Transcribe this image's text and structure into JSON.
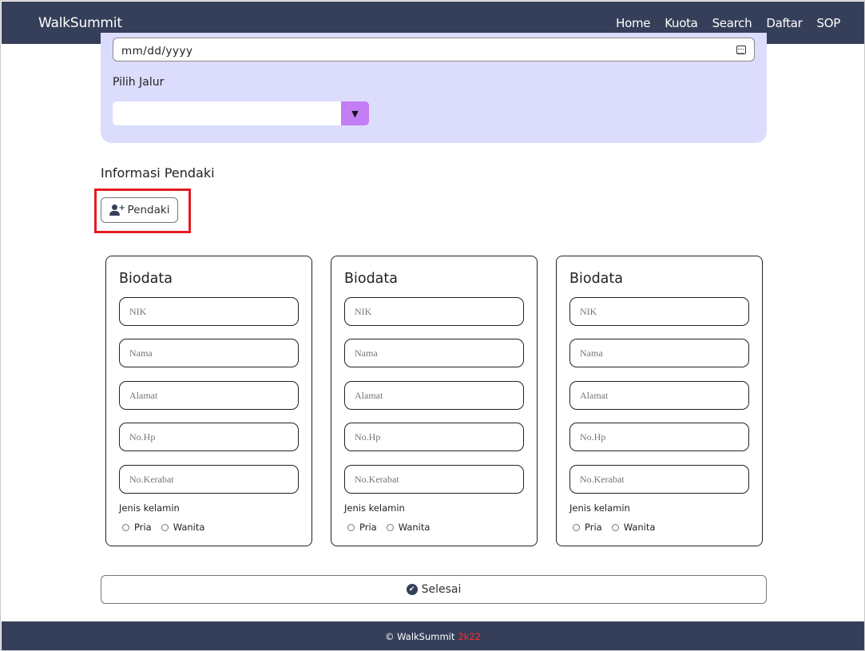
{
  "navbar": {
    "brand": "WalkSummit",
    "links": [
      "Home",
      "Kuota",
      "Search",
      "Daftar",
      "SOP"
    ]
  },
  "form": {
    "date_value": "mm/dd/yyyy",
    "jalur_label": "Pilih Jalur",
    "jalur_value": "",
    "dropdown_glyph": "▼"
  },
  "info": {
    "title": "Informasi Pendaki",
    "add_button_label": "Pendaki"
  },
  "cards": [
    {
      "title": "Biodata",
      "placeholders": [
        "NIK",
        "Nama",
        "Alamat",
        "No.Hp",
        "No.Kerabat"
      ],
      "gender_label": "Jenis kelamin",
      "options": [
        "Pria",
        "Wanita"
      ]
    },
    {
      "title": "Biodata",
      "placeholders": [
        "NIK",
        "Nama",
        "Alamat",
        "No.Hp",
        "No.Kerabat"
      ],
      "gender_label": "Jenis kelamin",
      "options": [
        "Pria",
        "Wanita"
      ]
    },
    {
      "title": "Biodata",
      "placeholders": [
        "NIK",
        "Nama",
        "Alamat",
        "No.Hp",
        "No.Kerabat"
      ],
      "gender_label": "Jenis kelamin",
      "options": [
        "Pria",
        "Wanita"
      ]
    }
  ],
  "submit_label": "Selesai",
  "footer": {
    "text": "© WalkSummit",
    "accent": "2k22"
  },
  "colors": {
    "navbar": "#353f59",
    "panel": "#dcdcfd",
    "dropdown_button": "#c47df5",
    "highlight": "#e31b23",
    "footer_accent": "#ff2b2b"
  },
  "icons": {
    "calendar": "calendar-icon",
    "dropdown": "caret-down-icon",
    "add_user": "user-plus-icon",
    "submit": "check-circle-icon"
  }
}
